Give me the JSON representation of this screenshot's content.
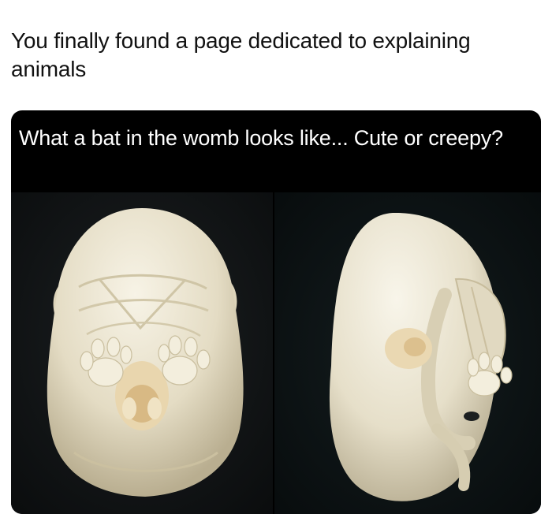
{
  "post": {
    "text": "You finally found a page dedicated to explaining animals"
  },
  "media": {
    "caption": "What a bat in the womb looks like... Cute or creepy?",
    "photos": [
      {
        "subject": "bat-embryo-front-view"
      },
      {
        "subject": "bat-embryo-side-view"
      }
    ]
  },
  "colors": {
    "page_background": "#ffffff",
    "text": "#111111",
    "card_background": "#000000",
    "caption_text": "#ffffff",
    "embryo_tone": "#ece6d2"
  }
}
